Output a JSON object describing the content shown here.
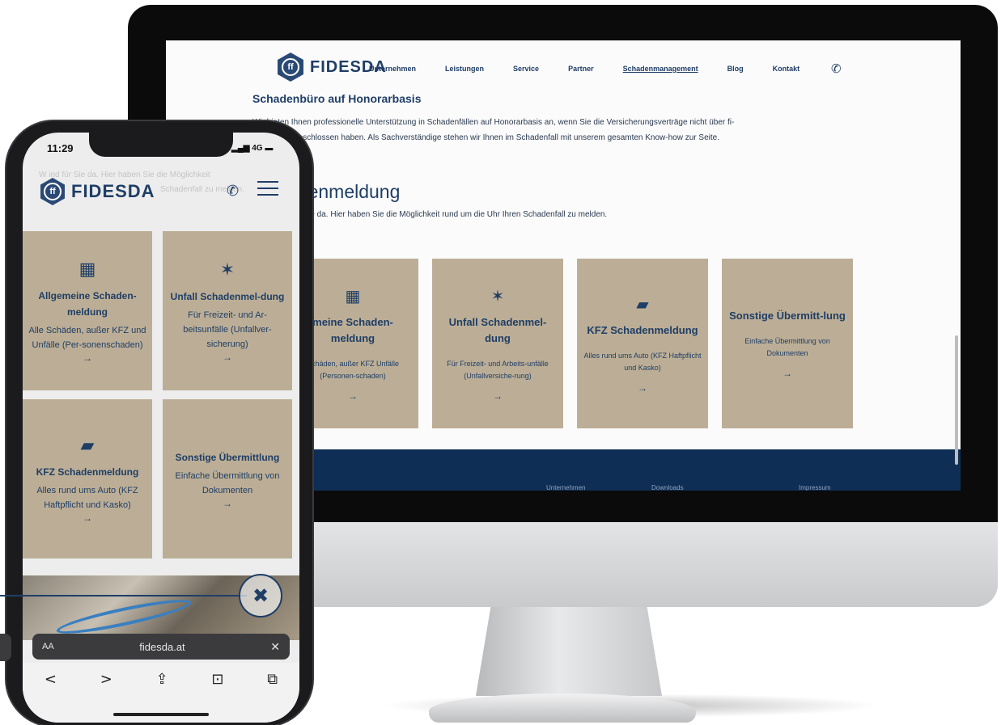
{
  "desktop": {
    "logo": "FIDESDA",
    "nav": [
      {
        "label": "Unternehmen",
        "active": false
      },
      {
        "label": "Leistungen",
        "active": false
      },
      {
        "label": "Service",
        "active": false
      },
      {
        "label": "Partner",
        "active": false
      },
      {
        "label": "Schadenmanagement",
        "active": true
      },
      {
        "label": "Blog",
        "active": false
      },
      {
        "label": "Kontakt",
        "active": false
      }
    ],
    "phone_icon": "phone-icon",
    "section_heading": "Schadenbüro auf Honorarbasis",
    "section_text_line1": "Wir bieten Ihnen professionelle Unterstützung in Schadenfällen auf Honorarbasis an, wenn Sie die Versicherungsverträge nicht über fi-",
    "section_text_line2": "abgeschlossen haben. Als Sachverständige stehen wir Ihnen im Schadenfall mit unserem gesamten Know-how zur Seite.",
    "page_heading": "adenmeldung",
    "page_subtext": "l für Sie da. Hier haben Sie die Möglichkeit rund um die Uhr Ihren Schadenfall zu melden.",
    "cards": [
      {
        "icon": "building-fire-icon",
        "title": "meine Schaden-meldung",
        "text": "Schäden, außer KFZ Unfälle (Personen-schaden)",
        "arrow": "→"
      },
      {
        "icon": "falling-person-icon",
        "title": "Unfall Schadenmel-dung",
        "text": "Für Freizeit- und Arbeits-unfälle (Unfallversiche-rung)",
        "arrow": "→"
      },
      {
        "icon": "car-crash-icon",
        "title": "KFZ Schadenmeldung",
        "text": "Alles rund ums Auto (KFZ Haftpflicht und Kasko)",
        "arrow": "→"
      },
      {
        "icon": "document-send-icon",
        "title": "Sonstige Übermitt-lung",
        "text": "Einfache Übermittlung von Dokumenten",
        "arrow": "→"
      }
    ],
    "footer_links": [
      "Unternehmen",
      "Downloads",
      "Impressum"
    ]
  },
  "mobile": {
    "status_time": "11:29",
    "status_network": "4G",
    "ghost_text_line1": "W  ind für Sie da. Hier haben Sie die Möglichkeit",
    "ghost_text_line2": "Schadenfall zu melden.",
    "logo": "FIDESDA",
    "cards": [
      {
        "icon": "building-fire-icon",
        "title": "Allgemeine Schaden-meldung",
        "text": "Alle Schäden, außer KFZ und Unfälle (Per-sonenschaden)",
        "arrow": "→"
      },
      {
        "icon": "falling-person-icon",
        "title": "Unfall Schadenmel-dung",
        "text": "Für Freizeit- und Ar-beitsunfälle (Unfallver-sicherung)",
        "arrow": "→"
      },
      {
        "icon": "car-crash-icon",
        "title": "KFZ Schadenmeldung",
        "text": "Alles rund ums Auto (KFZ Haftpflicht und Kasko)",
        "arrow": "→"
      },
      {
        "icon": "document-send-icon",
        "title": "Sonstige Übermittlung",
        "text": "Einfache Übermittlung von Dokumenten",
        "arrow": "→"
      }
    ],
    "url_aa": "AA",
    "url": "fidesda.at",
    "url_close": "✕",
    "toolbar": [
      "<",
      ">",
      "⇪",
      "⊡",
      "⧉"
    ]
  }
}
